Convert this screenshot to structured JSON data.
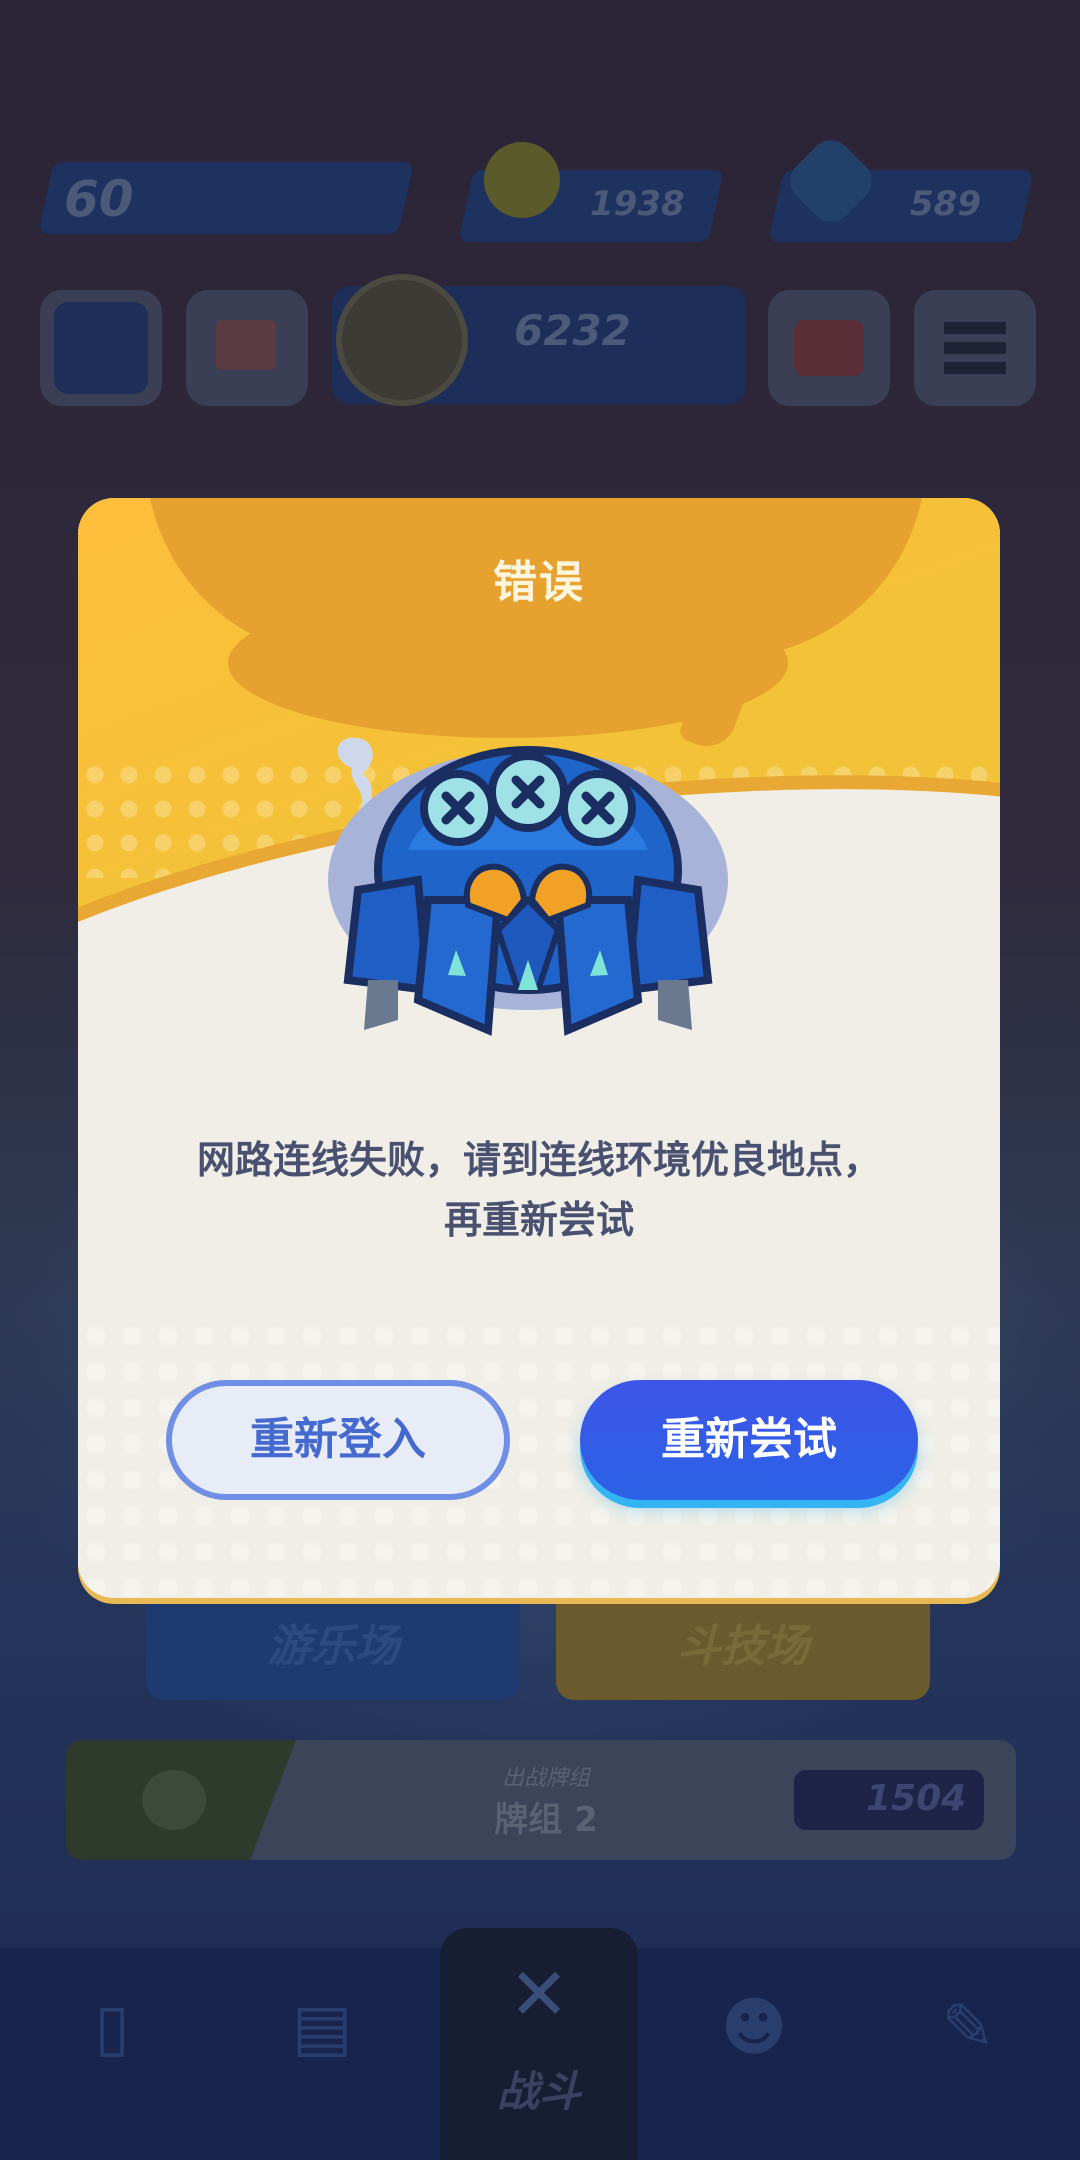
{
  "hud": {
    "level": "60",
    "coins": "1938",
    "gems": "589",
    "trophies": "6232"
  },
  "menu": {
    "mode_left": "游乐场",
    "mode_right": "斗技场",
    "deck_caption": "出战牌组",
    "deck_name": "牌组 2",
    "deck_power": "1504",
    "nav_battle": "战斗"
  },
  "dialog": {
    "title": "错误",
    "message_line1": "网路连线失败，请到连线环境优良地点，",
    "message_line2": "再重新尝试",
    "relogin_label": "重新登入",
    "retry_label": "重新尝试"
  },
  "colors": {
    "dialog_header": "#f3c238",
    "retry_button": "#2b62e6",
    "relogin_border": "#6f8fe4"
  }
}
